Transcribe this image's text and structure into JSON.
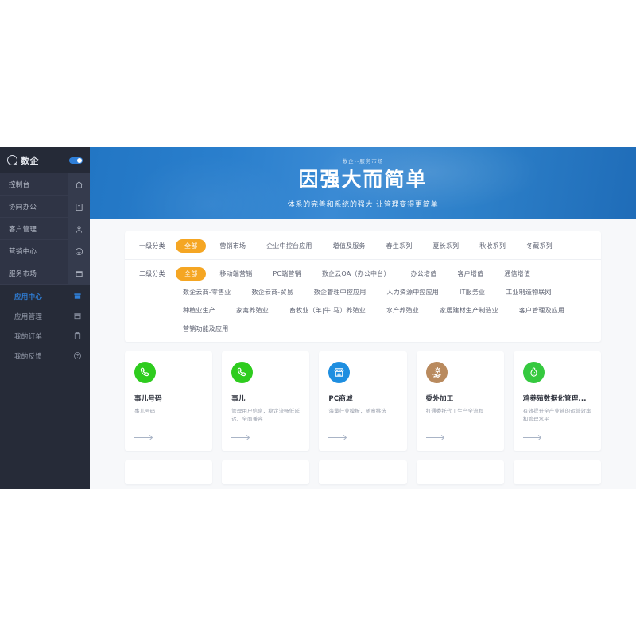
{
  "sidebar": {
    "logo": {
      "text": "数企",
      "mark_icon": "magnifier-logo-icon"
    },
    "toggle": {
      "name": "sidebar-collapse-toggle",
      "state": "on"
    },
    "items": [
      {
        "label": "控制台",
        "icon": "home-icon",
        "caret": ""
      },
      {
        "label": "协同办公",
        "icon": "document-icon",
        "caret": "‹"
      },
      {
        "label": "客户管理",
        "icon": "user-icon",
        "caret": "‹"
      },
      {
        "label": "营销中心",
        "icon": "smiley-icon",
        "caret": "‹"
      },
      {
        "label": "服务市场",
        "icon": "shop-icon",
        "caret": "⌄"
      }
    ],
    "subitems": [
      {
        "label": "应用中心",
        "icon": "shop-filled-icon",
        "active": true
      },
      {
        "label": "应用管理",
        "icon": "shop-outline-icon",
        "active": false
      },
      {
        "label": "我的订单",
        "icon": "clipboard-icon",
        "active": false
      },
      {
        "label": "我的反馈",
        "icon": "question-circle-icon",
        "active": false
      }
    ]
  },
  "hero": {
    "kicker": "数企--服务市场",
    "title": "因强大而简单",
    "subtitle": "体系的完善和系统的强大  让管理变得更简单"
  },
  "filters": {
    "primary": {
      "label": "一级分类",
      "tags": [
        "全部",
        "营销市场",
        "企业中控台应用",
        "增值及服务",
        "春生系列",
        "夏长系列",
        "秋收系列",
        "冬藏系列"
      ],
      "selected": "全部"
    },
    "secondary": {
      "label": "二级分类",
      "tags": [
        "全部",
        "移动端营销",
        "PC端营销",
        "数企云OA（办公中台）",
        "办公增值",
        "客户增值",
        "通信增值",
        "数企云商-零售业",
        "数企云商-贸易",
        "数企管理中控应用",
        "人力资源中控应用",
        "IT服务业",
        "工业制造物联网",
        "种植业生产",
        "家禽养殖业",
        "畜牧业（羊|牛|马）养殖业",
        "水产养殖业",
        "家居建材生产制造业",
        "客户管理及应用",
        "营销功能及应用"
      ],
      "selected": "全部"
    }
  },
  "cards": [
    {
      "title": "事儿号码",
      "desc": "事儿号码",
      "icon": "phone-icon",
      "icon_color": "#2ecc1e",
      "arrow": "arrow-right-icon"
    },
    {
      "title": "事儿",
      "desc": "管理用户信息，稳定流畅低延迟、全面兼容",
      "icon": "phone-icon",
      "icon_color": "#2ecc1e",
      "arrow": "arrow-right-icon"
    },
    {
      "title": "PC商城",
      "desc": "海量行业模板，随意挑选",
      "icon": "storefront-icon",
      "icon_color": "#1e8ee0",
      "arrow": "arrow-right-icon"
    },
    {
      "title": "委外加工",
      "desc": "打通委托代工生产全流程",
      "icon": "hand-gear-icon",
      "icon_color": "#b98a5e",
      "arrow": "arrow-right-icon"
    },
    {
      "title": "鸡养殖数据化管理...",
      "desc": "有效提升全产业链的运营效率和管理水平",
      "icon": "chicken-icon",
      "icon_color": "#35c93f",
      "arrow": "arrow-right-icon"
    }
  ],
  "colors": {
    "accent_orange": "#f5a623",
    "accent_blue": "#2f7fd8",
    "sidebar_bg": "#2a2f3d",
    "sidebar_sub_bg": "#262b38",
    "page_bg": "#f7f8fa"
  }
}
